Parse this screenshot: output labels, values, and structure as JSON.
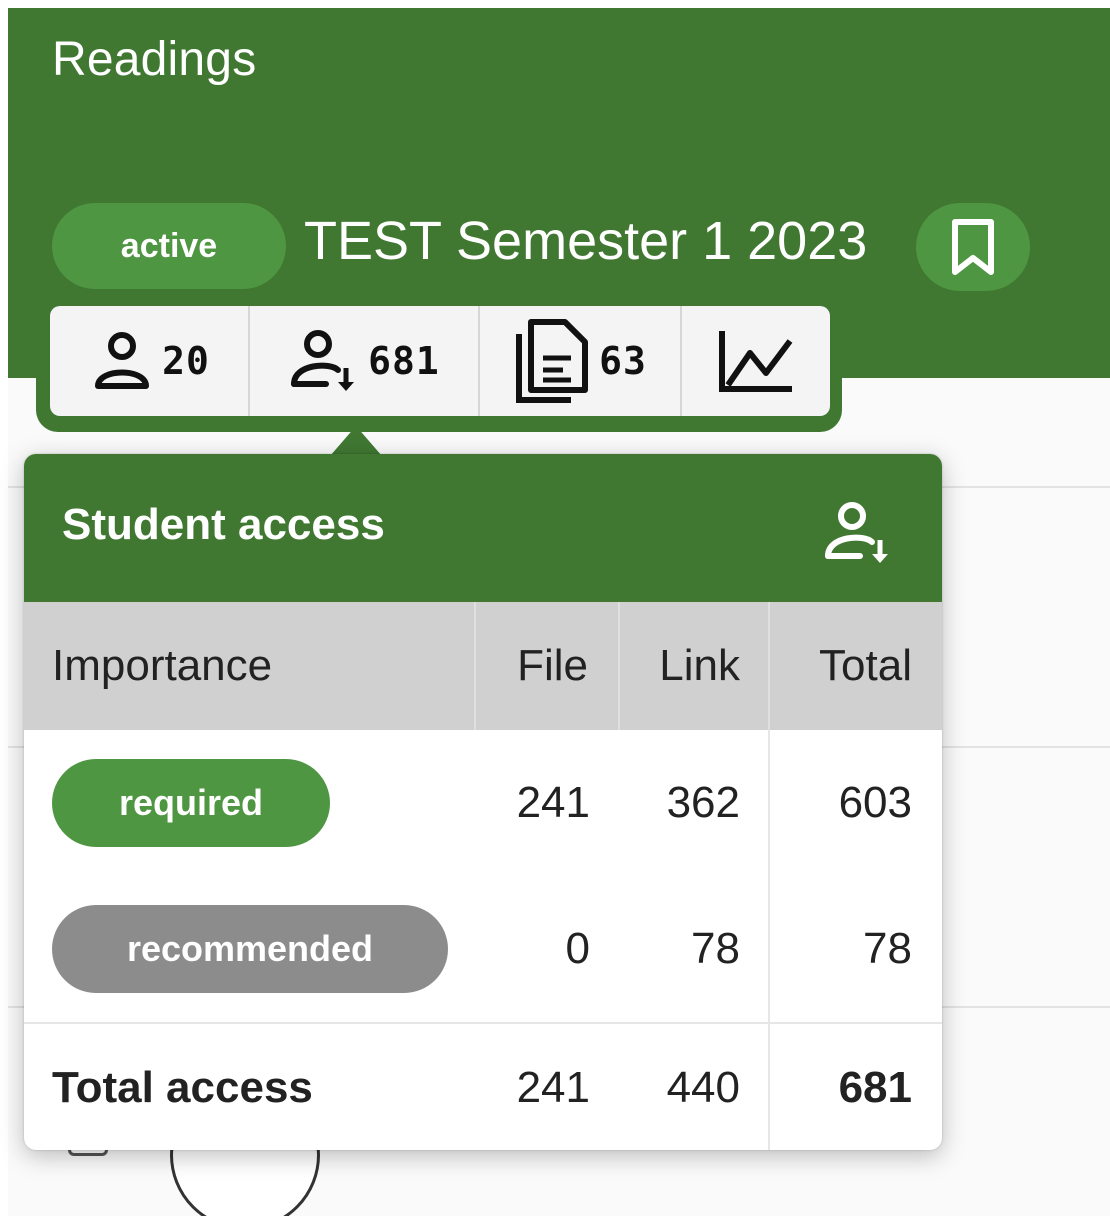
{
  "header": {
    "title": "Readings",
    "status": "active",
    "course_title": "TEST Semester 1 2023",
    "icons": {
      "bookmark": "bookmark-icon"
    }
  },
  "stats": {
    "users": {
      "icon": "user-icon",
      "count": "20"
    },
    "access": {
      "icon": "user-download-icon",
      "count": "681"
    },
    "readings": {
      "icon": "documents-icon",
      "count": "63"
    },
    "analytics": {
      "icon": "line-chart-icon"
    }
  },
  "popover": {
    "title": "Student access",
    "icon": "user-download-icon",
    "columns": [
      "Importance",
      "File",
      "Link",
      "Total"
    ],
    "rows": [
      {
        "importance": "required",
        "file": "241",
        "link": "362",
        "total": "603",
        "color": "#4e9641"
      },
      {
        "importance": "recommended",
        "file": "0",
        "link": "78",
        "total": "78",
        "color": "#8c8c8c"
      }
    ],
    "total_row": {
      "label": "Total access",
      "file": "241",
      "link": "440",
      "total": "681"
    }
  },
  "colors": {
    "brand_green": "#407832",
    "pill_green": "#4e9641",
    "pill_grey": "#8c8c8c"
  }
}
